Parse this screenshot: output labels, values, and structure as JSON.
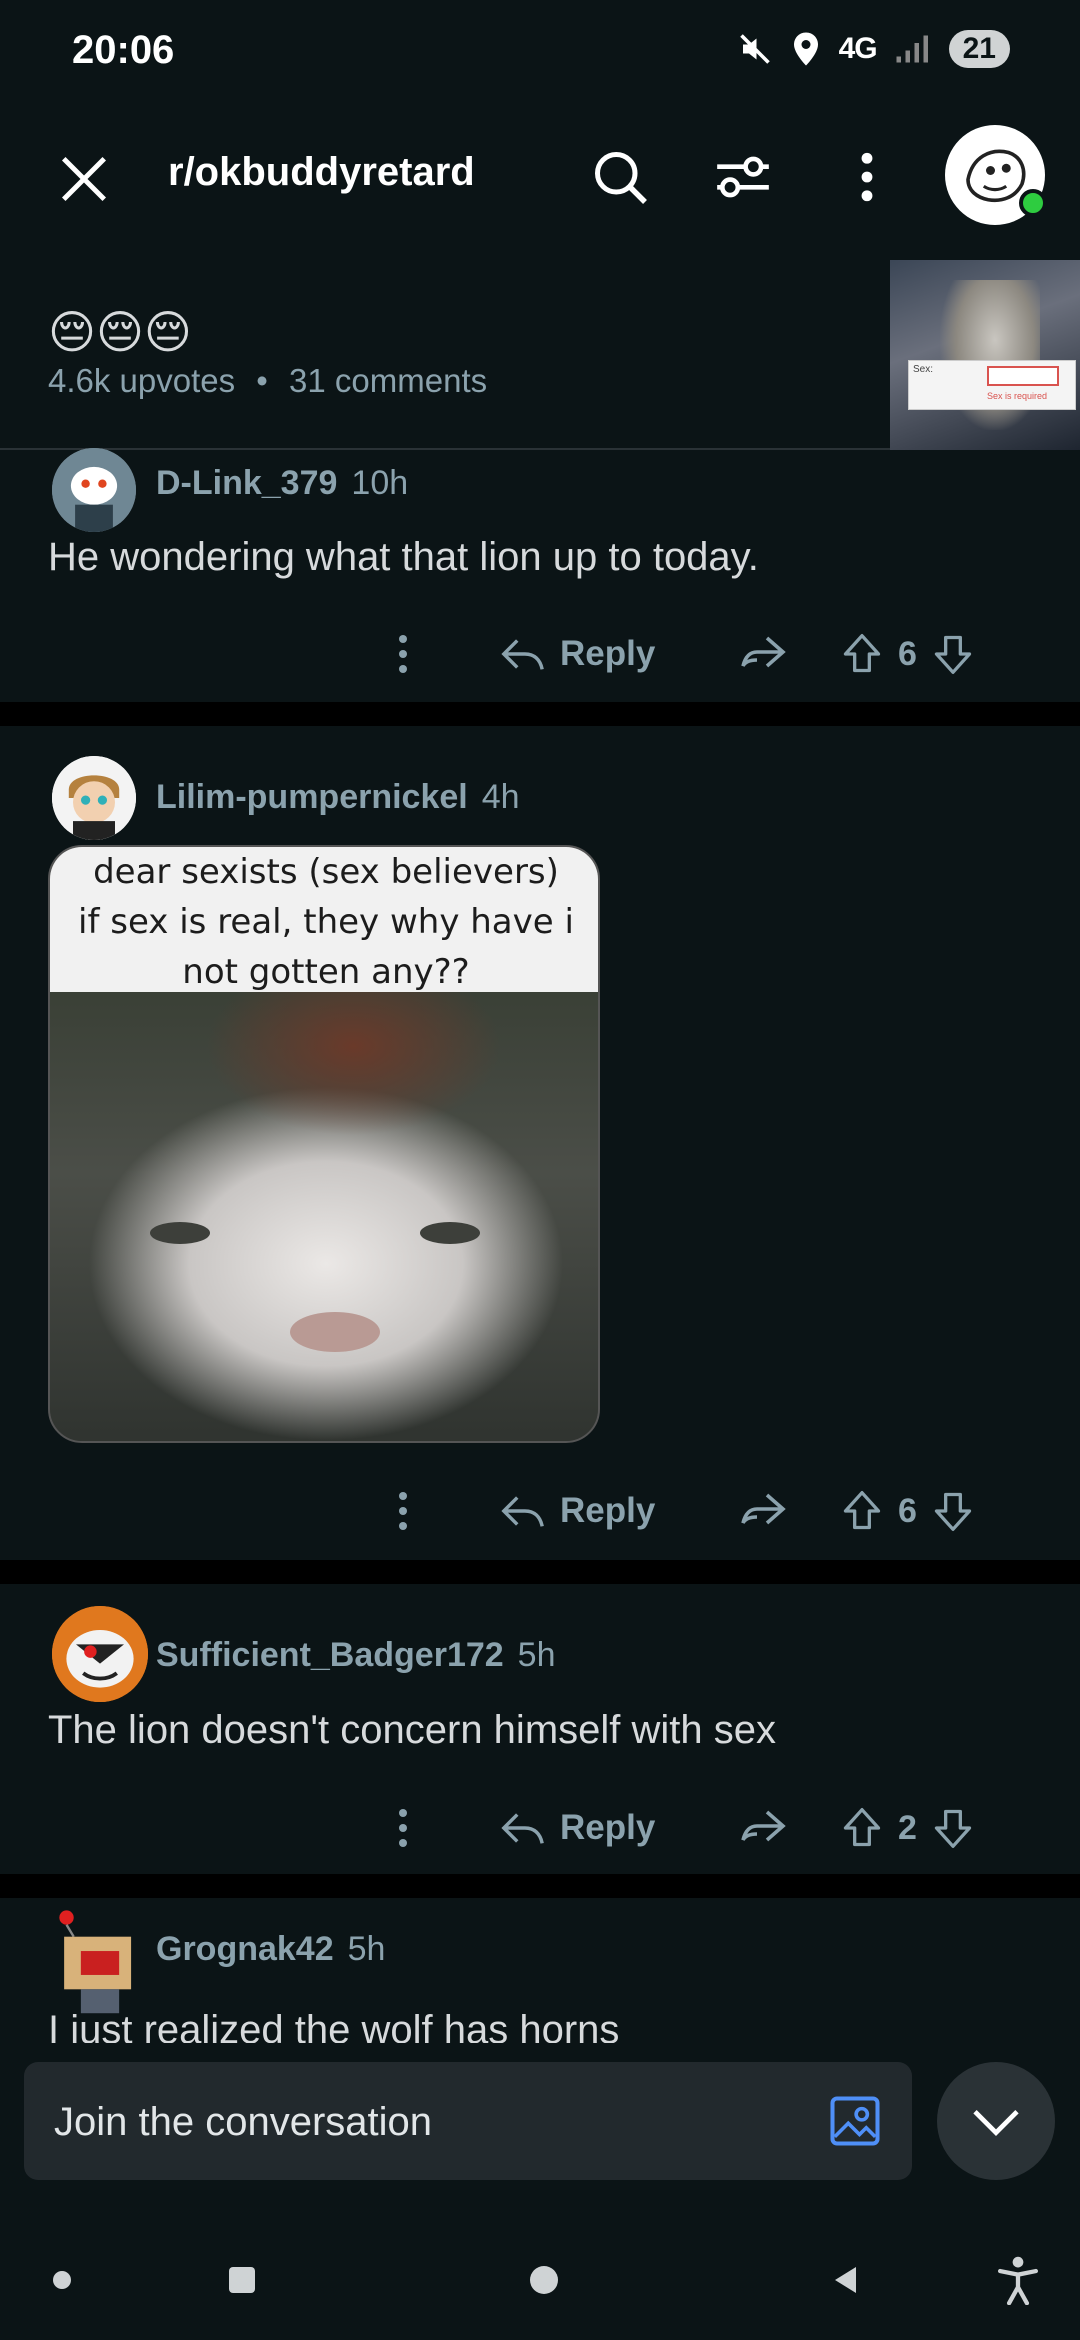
{
  "status_bar": {
    "time": "20:06",
    "network": "4G",
    "battery": "21",
    "icons": [
      "mute-icon",
      "location-icon",
      "signal-icon",
      "battery-icon"
    ]
  },
  "header": {
    "subreddit": "r/okbuddyretard",
    "icons": [
      "close-icon",
      "search-icon",
      "filter-icon",
      "more-icon",
      "user-avatar"
    ]
  },
  "post": {
    "title_emoji": "😔😔😔",
    "upvotes": "4.6k upvotes",
    "dot": "•",
    "comments": "31 comments",
    "thumb_label": "Sex:",
    "thumb_error": "Sex is required"
  },
  "comments": [
    {
      "author": "D-Link_379",
      "age": "10h",
      "text": "He wondering what that lion up to today.",
      "reply_label": "Reply",
      "votes": "6"
    },
    {
      "author": "Lilim-pumpernickel",
      "age": "4h",
      "image_caption": [
        "dear sexists (sex believers)",
        "if sex is real, they why have i",
        "not gotten any??"
      ],
      "reply_label": "Reply",
      "votes": "6"
    },
    {
      "author": "Sufficient_Badger172",
      "age": "5h",
      "text": "The lion doesn't concern himself with sex",
      "reply_label": "Reply",
      "votes": "2"
    },
    {
      "author": "Grognak42",
      "age": "5h",
      "text": "I just realized the wolf has horns"
    }
  ],
  "composer": {
    "placeholder": "Join the conversation"
  },
  "colors": {
    "background": "#0b1416",
    "separator": "#000000",
    "muted_text": "#8ba2ad",
    "accent_blue": "#4f8ff7",
    "online": "#2ecc40"
  }
}
